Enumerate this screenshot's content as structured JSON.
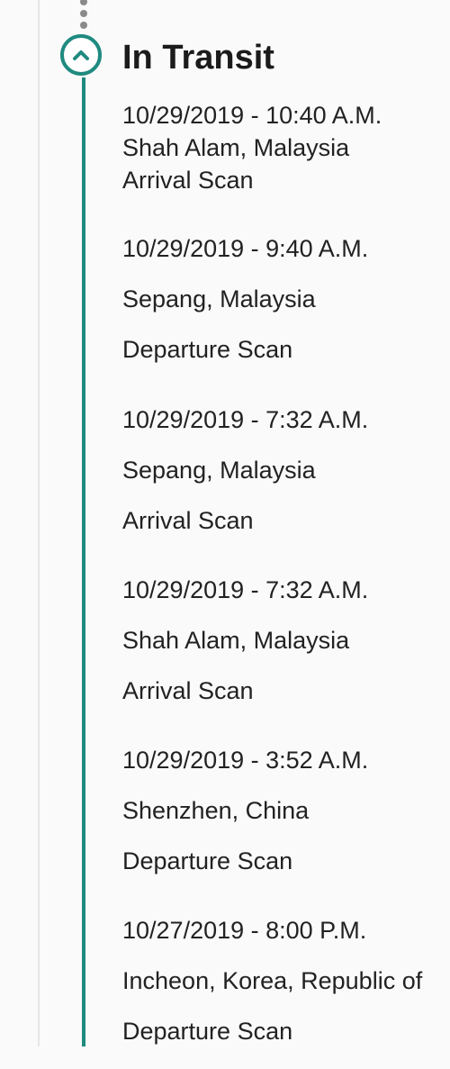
{
  "status": {
    "title": "In Transit",
    "icon": "chevron-up-icon",
    "accent_color": "#1f8a80"
  },
  "events": [
    {
      "datetime": "10/29/2019 - 10:40 A.M.",
      "location": "Shah Alam, Malaysia",
      "activity": "Arrival Scan"
    },
    {
      "datetime": "10/29/2019 - 9:40 A.M.",
      "location": "Sepang, Malaysia",
      "activity": "Departure Scan"
    },
    {
      "datetime": "10/29/2019 - 7:32 A.M.",
      "location": "Sepang, Malaysia",
      "activity": "Arrival Scan"
    },
    {
      "datetime": "10/29/2019 - 7:32 A.M.",
      "location": "Shah Alam, Malaysia",
      "activity": "Arrival Scan"
    },
    {
      "datetime": "10/29/2019 - 3:52 A.M.",
      "location": "Shenzhen, China",
      "activity": "Departure Scan"
    },
    {
      "datetime": "10/27/2019 - 8:00 P.M.",
      "location": "Incheon, Korea, Republic of",
      "activity": "Departure Scan"
    }
  ]
}
